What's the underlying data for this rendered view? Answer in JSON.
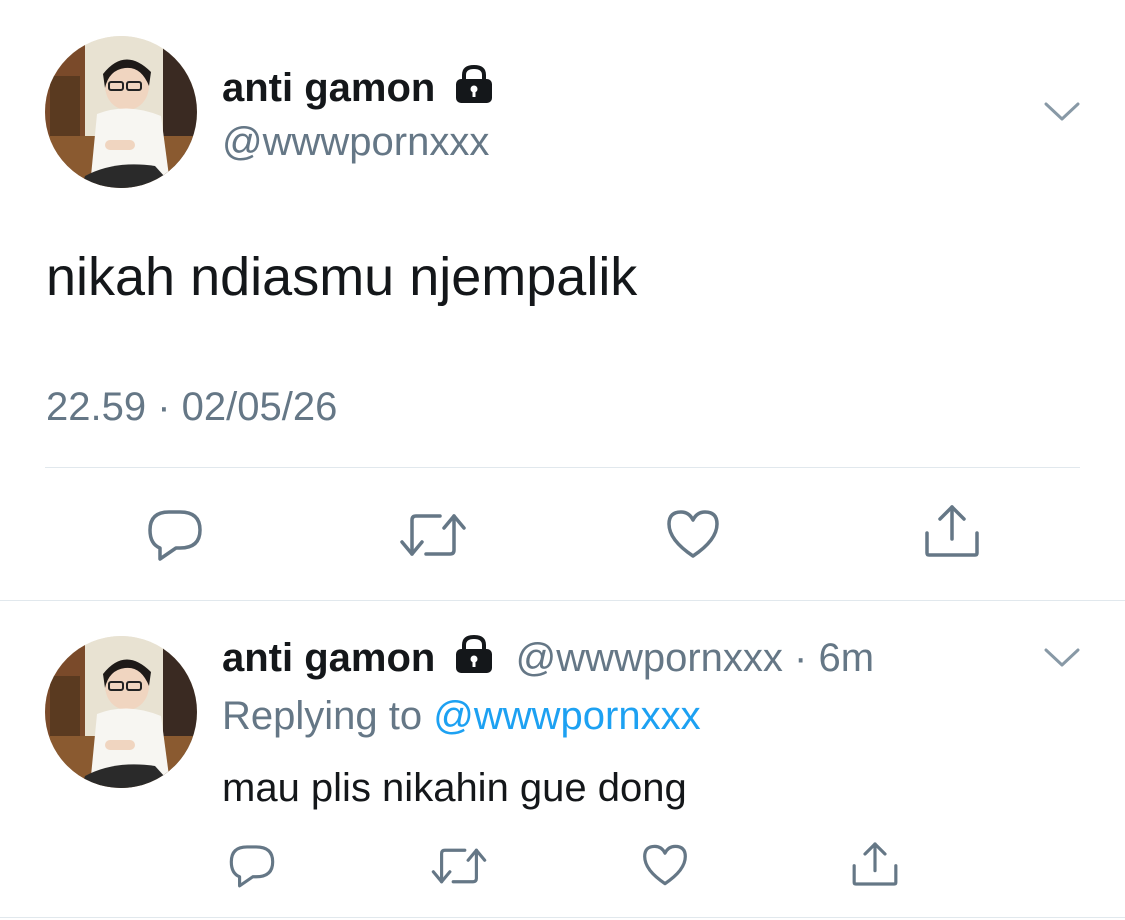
{
  "main_tweet": {
    "display_name": "anti gamon",
    "handle": "@wwwpornxxx",
    "text": "nikah ndiasmu njempalik",
    "timestamp": "22.59 · 02/05/26",
    "protected_icon": "lock-icon",
    "menu_icon": "chevron-down-icon",
    "actions": [
      "reply-icon",
      "retweet-icon",
      "like-icon",
      "share-icon"
    ]
  },
  "reply_tweet": {
    "display_name": "anti gamon",
    "handle": "@wwwpornxxx",
    "separator": "·",
    "time_ago": "6m",
    "replying_to_label": "Replying to",
    "replying_to_handle": "@wwwpornxxx",
    "text": "mau plis nikahin gue dong",
    "protected_icon": "lock-icon",
    "menu_icon": "chevron-down-icon",
    "actions": [
      "reply-icon",
      "retweet-icon",
      "like-icon",
      "share-icon"
    ]
  },
  "colors": {
    "text_primary": "#14171a",
    "text_secondary": "#657786",
    "link": "#1da1f2",
    "divider": "#e1e8ed"
  }
}
